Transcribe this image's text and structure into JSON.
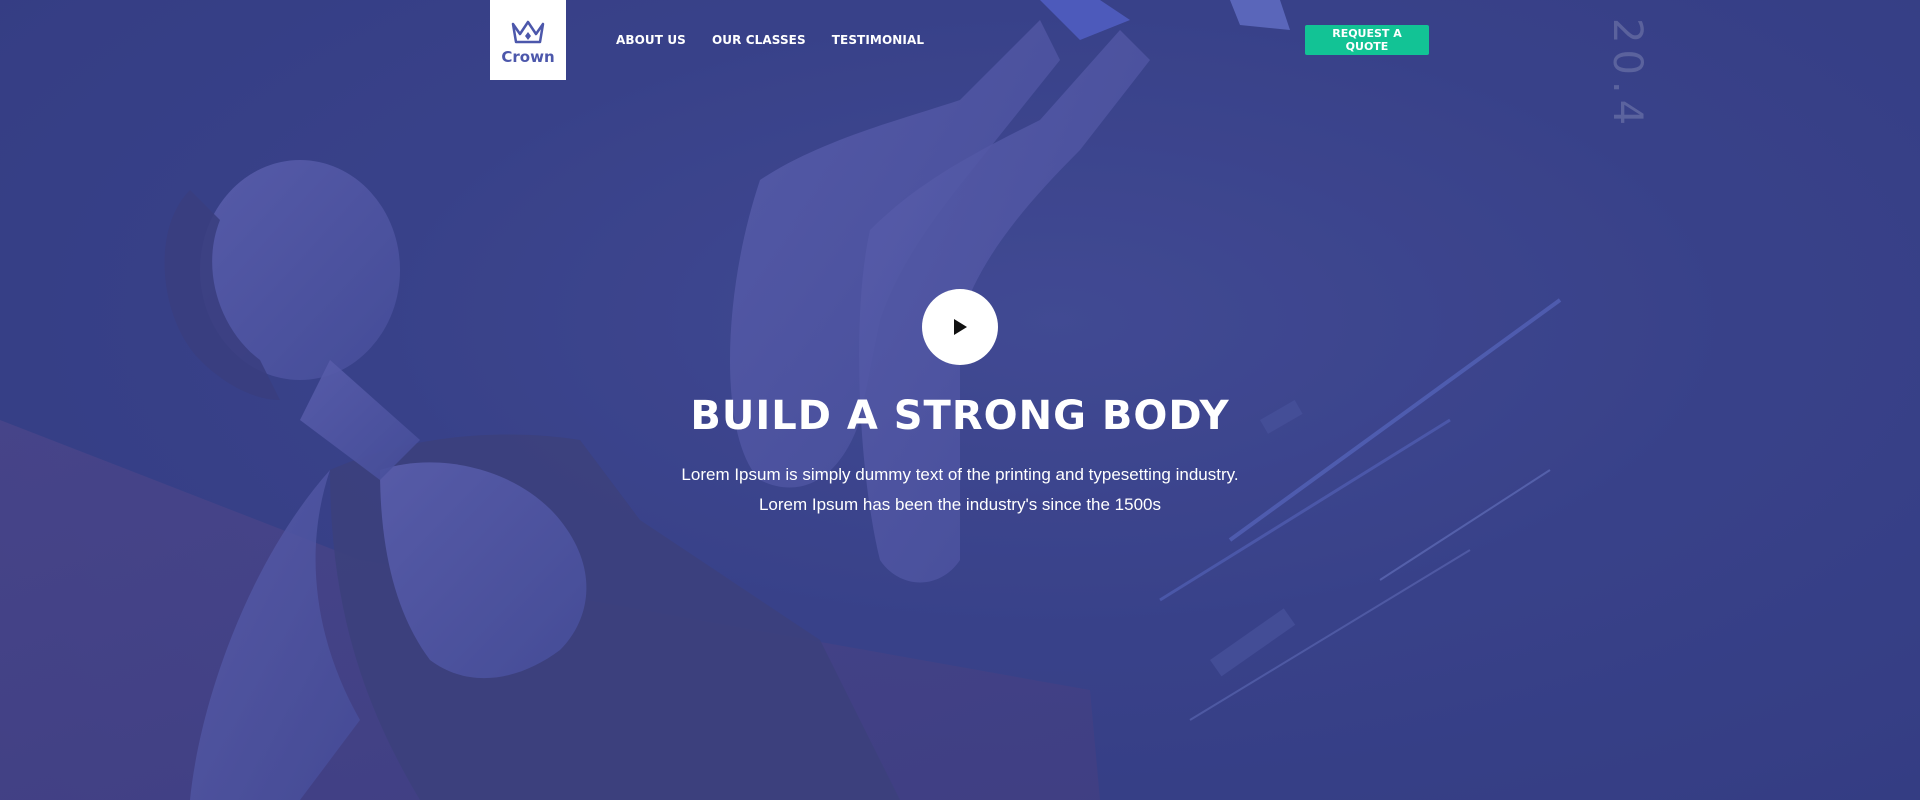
{
  "header": {
    "logo": {
      "text": "Crown",
      "icon": "crown-icon"
    },
    "nav": [
      {
        "label": "ABOUT US"
      },
      {
        "label": "OUR CLASSES"
      },
      {
        "label": "TESTIMONIAL"
      }
    ],
    "cta_label": "REQUEST A QUOTE"
  },
  "hero": {
    "play_icon": "play-icon",
    "title": "BUILD A STRONG BODY",
    "subtitle_line1": "Lorem Ipsum is simply dummy text of the printing and typesetting industry.",
    "subtitle_line2": "Lorem Ipsum has been the industry's since the 1500s",
    "background_text": "20.4"
  },
  "colors": {
    "overlay": "#363f86",
    "accent": "#12c395",
    "logo_text": "#4c57ab",
    "white": "#ffffff"
  }
}
